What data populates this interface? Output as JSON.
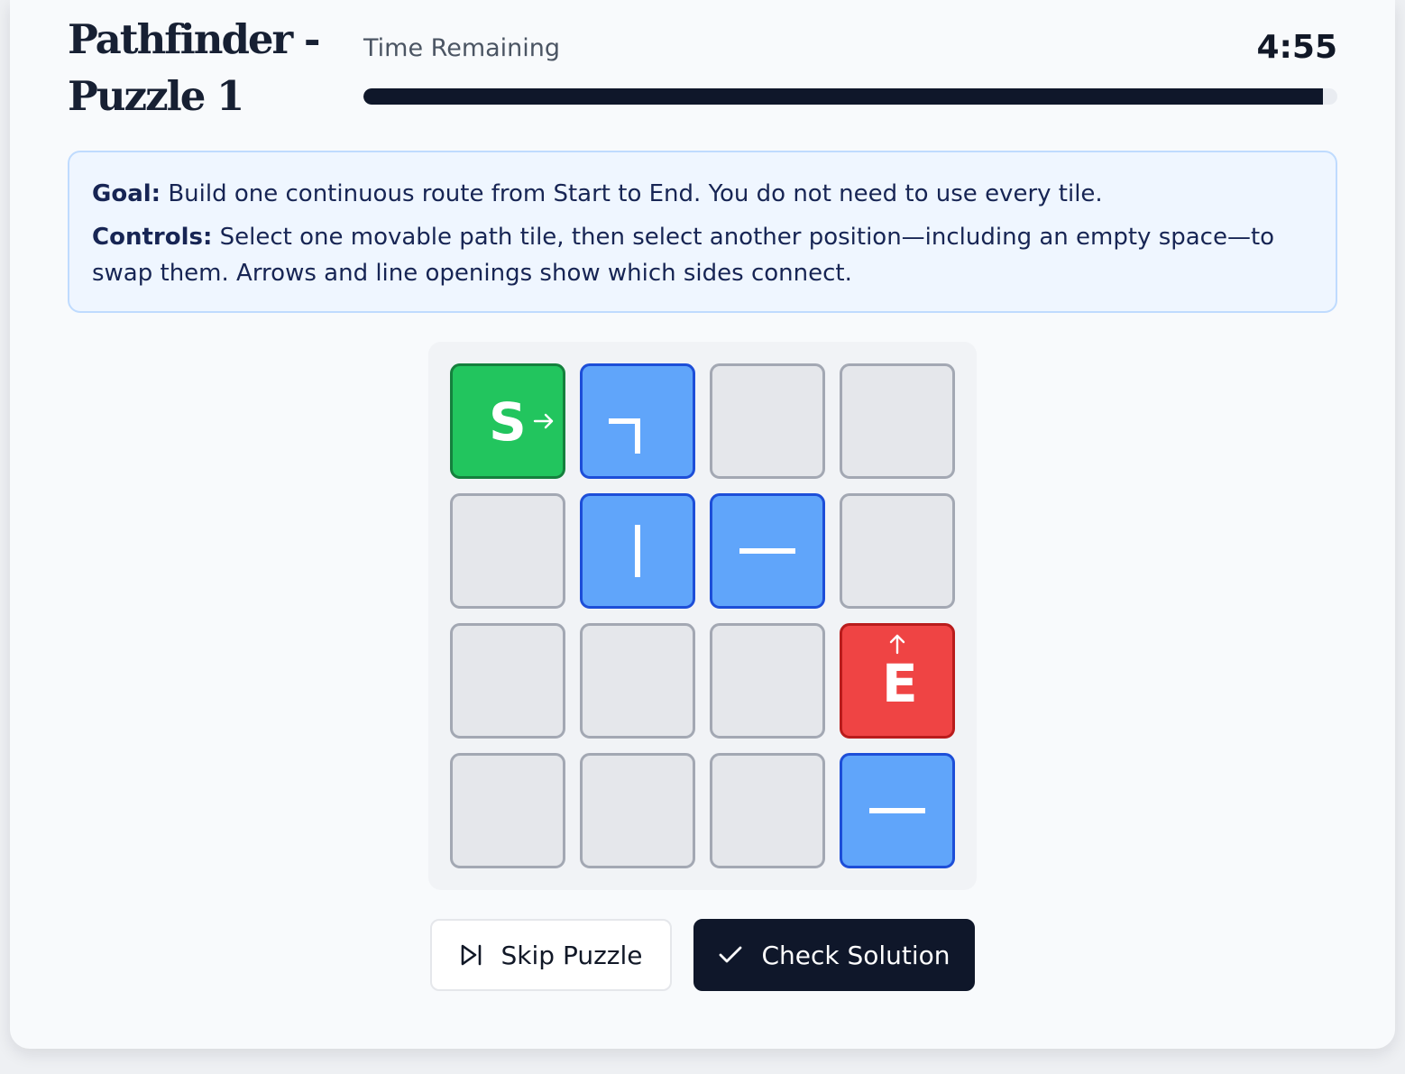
{
  "header": {
    "title": "Pathfinder - Puzzle 1",
    "timer_label": "Time Remaining",
    "timer_value": "4:55",
    "time_remaining_fraction": 0.985
  },
  "instructions": {
    "goal_label": "Goal:",
    "goal_text": "Build one continuous route from Start to End. You do not need to use every tile.",
    "controls_label": "Controls:",
    "controls_text": "Select one movable path tile, then select another position—including an empty space—to swap them. Arrows and line openings show which sides connect."
  },
  "board": {
    "rows": 4,
    "cols": 4,
    "tiles": [
      [
        "start",
        "corner-left-down",
        "empty",
        "empty"
      ],
      [
        "empty",
        "vertical",
        "horizontal",
        "empty"
      ],
      [
        "empty",
        "empty",
        "empty",
        "end"
      ],
      [
        "empty",
        "empty",
        "empty",
        "horizontal"
      ]
    ],
    "start": {
      "row": 0,
      "col": 0,
      "letter": "S",
      "exit": "right"
    },
    "end": {
      "row": 2,
      "col": 3,
      "letter": "E",
      "entry": "up"
    }
  },
  "buttons": {
    "skip_label": "Skip Puzzle",
    "skip_icon": "skip-forward-icon",
    "check_label": "Check Solution",
    "check_icon": "check-icon"
  },
  "colors": {
    "start_tile": "#22c55e",
    "end_tile": "#ef4444",
    "path_tile": "#60a5fa",
    "empty_tile": "#e5e7eb",
    "progress_fill": "#0f172a"
  }
}
